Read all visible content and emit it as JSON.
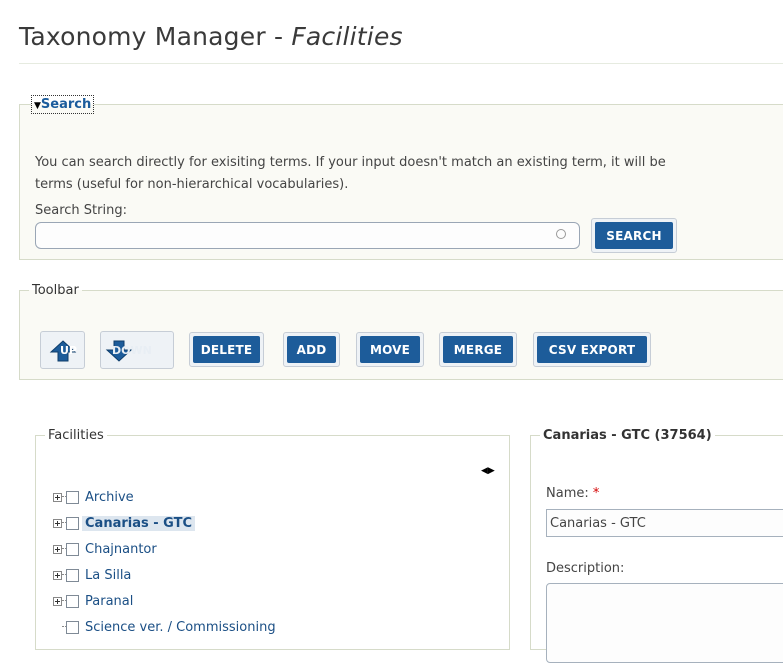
{
  "page": {
    "title_prefix": "Taxonomy Manager - ",
    "title_vocab": "Facilities"
  },
  "search": {
    "legend": "Search",
    "help_line1": "You can search directly for exisiting terms. If your input doesn't match an existing term, it will be",
    "help_line2": "terms (useful for non-hierarchical vocabularies).",
    "label": "Search String:",
    "value": "",
    "button": "SEARCH"
  },
  "toolbar": {
    "legend": "Toolbar",
    "up_label": "UP",
    "down_label": "DOWN",
    "delete": "DELETE",
    "add": "ADD",
    "move": "MOVE",
    "merge": "MERGE",
    "csv_export": "CSV EXPORT"
  },
  "tree": {
    "legend": "Facilities",
    "items": [
      {
        "label": "Archive"
      },
      {
        "label": "Canarias - GTC",
        "selected": true
      },
      {
        "label": "Chajnantor"
      },
      {
        "label": "La Silla"
      },
      {
        "label": "Paranal"
      },
      {
        "label": "Science ver. / Commissioning"
      }
    ]
  },
  "detail": {
    "legend": "Canarias - GTC (37564)",
    "name_label": "Name:",
    "required_mark": "*",
    "name_value": "Canarias - GTC",
    "description_label": "Description:",
    "description_value": ""
  },
  "colors": {
    "button_blue": "#1d5c9a",
    "link_blue": "#1b4f85",
    "required_red": "#d40000"
  }
}
